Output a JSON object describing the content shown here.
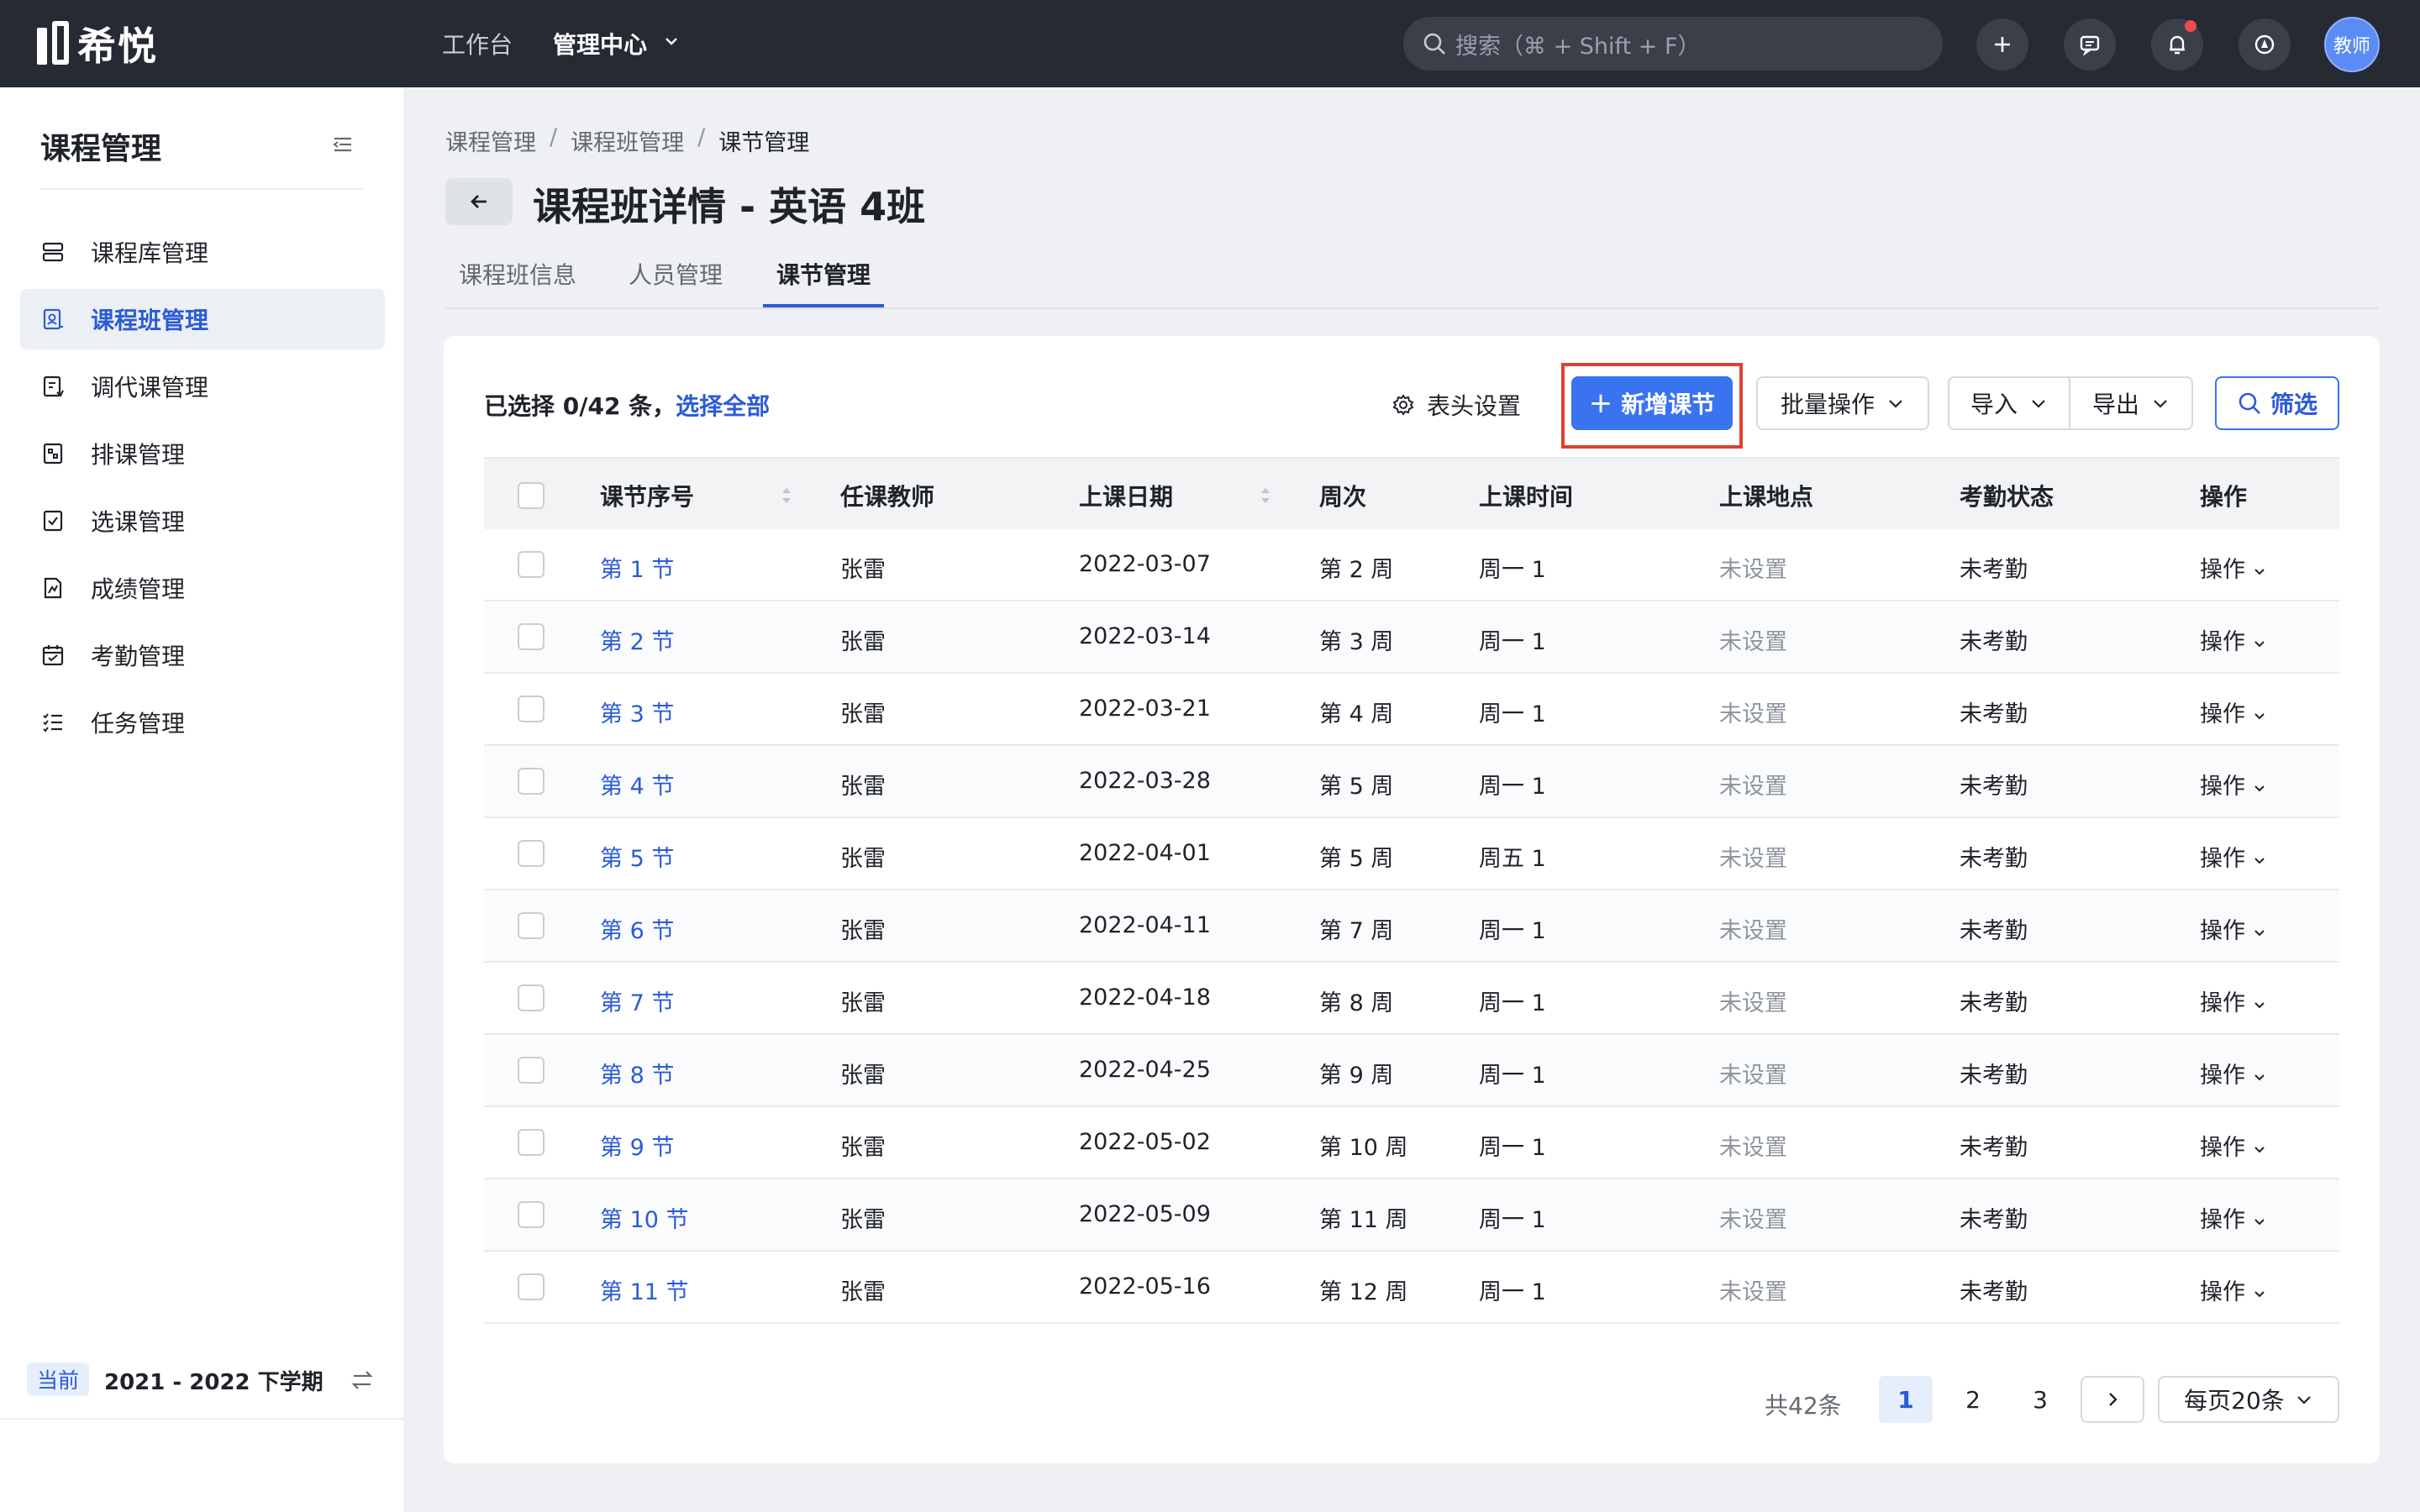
{
  "topbar": {
    "logo_text": "希悦",
    "nav": [
      "工作台",
      "管理中心"
    ],
    "search_placeholder": "搜索（⌘ + Shift + F）",
    "avatar_text": "教师"
  },
  "sidebar": {
    "title": "课程管理",
    "items": [
      {
        "label": "课程库管理",
        "icon": "library-icon"
      },
      {
        "label": "课程班管理",
        "icon": "class-icon",
        "active": true
      },
      {
        "label": "调代课管理",
        "icon": "swap-icon"
      },
      {
        "label": "排课管理",
        "icon": "schedule-icon"
      },
      {
        "label": "选课管理",
        "icon": "select-icon"
      },
      {
        "label": "成绩管理",
        "icon": "grade-icon"
      },
      {
        "label": "考勤管理",
        "icon": "calendar-icon"
      },
      {
        "label": "任务管理",
        "icon": "task-icon"
      }
    ],
    "term_badge": "当前",
    "term_text": "2021 - 2022 下学期"
  },
  "breadcrumb": [
    "课程管理",
    "课程班管理",
    "课节管理"
  ],
  "page_title": "课程班详情 - 英语 4班",
  "tabs": [
    "课程班信息",
    "人员管理",
    "课节管理"
  ],
  "toolbar": {
    "selection_prefix": "已选择 0/42 条，",
    "select_all": "选择全部",
    "header_settings": "表头设置",
    "add_lesson": "新增课节",
    "batch": "批量操作",
    "import": "导入",
    "export": "导出",
    "filter": "筛选"
  },
  "table": {
    "columns": [
      "课节序号",
      "任课教师",
      "上课日期",
      "周次",
      "上课时间",
      "上课地点",
      "考勤状态",
      "操作"
    ],
    "rows": [
      [
        "第 1 节",
        "张雷",
        "2022-03-07",
        "第 2 周",
        "周一 1",
        "未设置",
        "未考勤",
        "操作"
      ],
      [
        "第 2 节",
        "张雷",
        "2022-03-14",
        "第 3 周",
        "周一 1",
        "未设置",
        "未考勤",
        "操作"
      ],
      [
        "第 3 节",
        "张雷",
        "2022-03-21",
        "第 4 周",
        "周一 1",
        "未设置",
        "未考勤",
        "操作"
      ],
      [
        "第 4 节",
        "张雷",
        "2022-03-28",
        "第 5 周",
        "周一 1",
        "未设置",
        "未考勤",
        "操作"
      ],
      [
        "第 5 节",
        "张雷",
        "2022-04-01",
        "第 5 周",
        "周五 1",
        "未设置",
        "未考勤",
        "操作"
      ],
      [
        "第 6 节",
        "张雷",
        "2022-04-11",
        "第 7 周",
        "周一 1",
        "未设置",
        "未考勤",
        "操作"
      ],
      [
        "第 7 节",
        "张雷",
        "2022-04-18",
        "第 8 周",
        "周一 1",
        "未设置",
        "未考勤",
        "操作"
      ],
      [
        "第 8 节",
        "张雷",
        "2022-04-25",
        "第 9 周",
        "周一 1",
        "未设置",
        "未考勤",
        "操作"
      ],
      [
        "第 9 节",
        "张雷",
        "2022-05-02",
        "第 10 周",
        "周一 1",
        "未设置",
        "未考勤",
        "操作"
      ],
      [
        "第 10 节",
        "张雷",
        "2022-05-09",
        "第 11 周",
        "周一 1",
        "未设置",
        "未考勤",
        "操作"
      ],
      [
        "第 11 节",
        "张雷",
        "2022-05-16",
        "第 12 周",
        "周一 1",
        "未设置",
        "未考勤",
        "操作"
      ]
    ]
  },
  "pagination": {
    "total": "共42条",
    "pages": [
      "1",
      "2",
      "3"
    ],
    "current": "1",
    "page_size": "每页20条"
  },
  "colors": {
    "accent": "#3a73f0",
    "topbar": "#262a33",
    "highlight": "#e0402f"
  }
}
